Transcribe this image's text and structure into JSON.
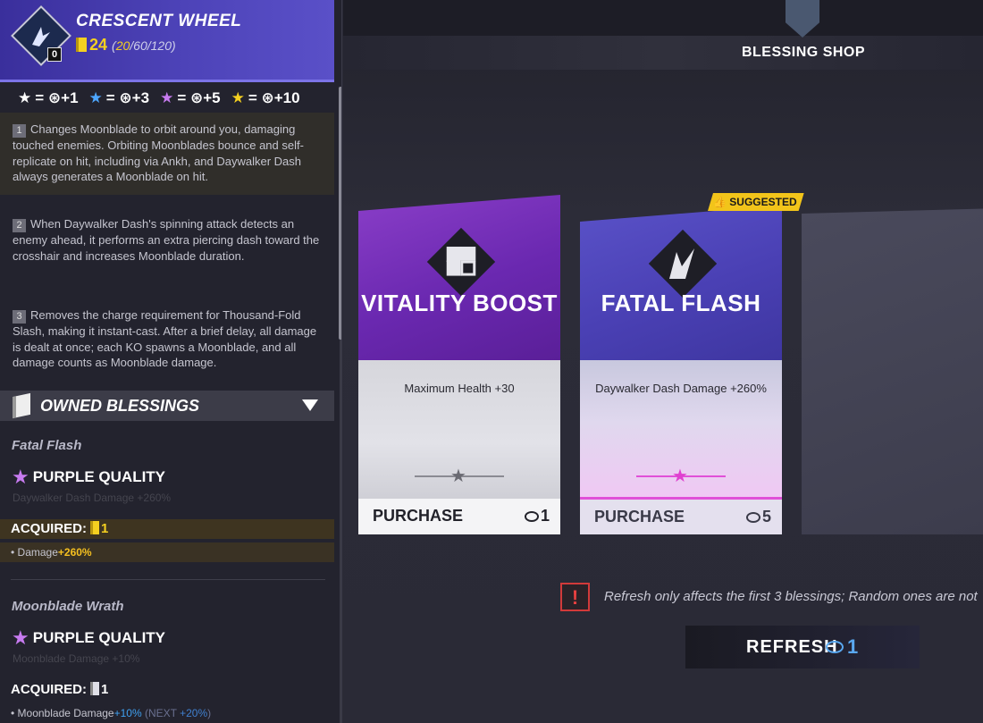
{
  "wheel": {
    "title": "CRESCENT WHEEL",
    "points": "24",
    "tiers_open": "(",
    "tier_current": "20",
    "tiers_rest": "/60/120)",
    "badge": "0"
  },
  "star_rates": [
    {
      "star": "★",
      "color": "#ffffff",
      "text": "= ⊛+1"
    },
    {
      "star": "★",
      "color": "#4da6ff",
      "text": "= ⊛+3"
    },
    {
      "star": "★",
      "color": "#c77bf0",
      "text": "= ⊛+5"
    },
    {
      "star": "★",
      "color": "#f5d020",
      "text": "= ⊛+10"
    }
  ],
  "descriptions": [
    {
      "num": "1",
      "text": "Changes Moonblade to orbit around you, damaging touched enemies. Orbiting Moonblades bounce and self-replicate on hit, including via Ankh, and Daywalker Dash always generates a Moonblade on hit."
    },
    {
      "num": "2",
      "text": "When Daywalker Dash's spinning attack detects an enemy ahead, it performs an extra piercing dash toward the crosshair and increases Moonblade duration."
    },
    {
      "num": "3",
      "text": "Removes the charge requirement for Thousand-Fold Slash, making it instant-cast. After a brief delay, all damage is dealt at once; each KO spawns a Moonblade, and all damage counts as Moonblade damage."
    }
  ],
  "owned": {
    "header": "OWNED BLESSINGS",
    "items": [
      {
        "name": "Fatal Flash",
        "quality": "PURPLE QUALITY",
        "faint": "Daywalker Dash Damage +260%",
        "acquired_label": "ACQUIRED:",
        "acquired_count": "1",
        "stat_label": "• Damage",
        "stat_value": "+260%"
      },
      {
        "name": "Moonblade Wrath",
        "quality": "PURPLE QUALITY",
        "faint": "Moonblade Damage +10%",
        "acquired_label": "ACQUIRED:",
        "acquired_count": "1",
        "stat_label": "• Moonblade Damage",
        "stat_value": "+10%",
        "next_open": " (NEXT ",
        "next_value": "+20%",
        "next_close": ")"
      }
    ]
  },
  "shop": {
    "title": "BLESSING SHOP",
    "suggested": "SUGGESTED",
    "cards": [
      {
        "name": "VITALITY BOOST",
        "effect": "Maximum Health +30",
        "purchase": "PURCHASE",
        "cost": "1"
      },
      {
        "name": "FATAL FLASH",
        "effect": "Daywalker Dash Damage +260%",
        "purchase": "PURCHASE",
        "cost": "5"
      }
    ],
    "notice": "Refresh only affects the first 3 blessings; Random ones are not",
    "notice_icon": "!",
    "refresh_label": "REFRESH",
    "refresh_cost": "1"
  },
  "colors": {
    "purple_star": "#c77bf0",
    "gold": "#f5d020",
    "blue_cost": "#5aa8f0"
  }
}
